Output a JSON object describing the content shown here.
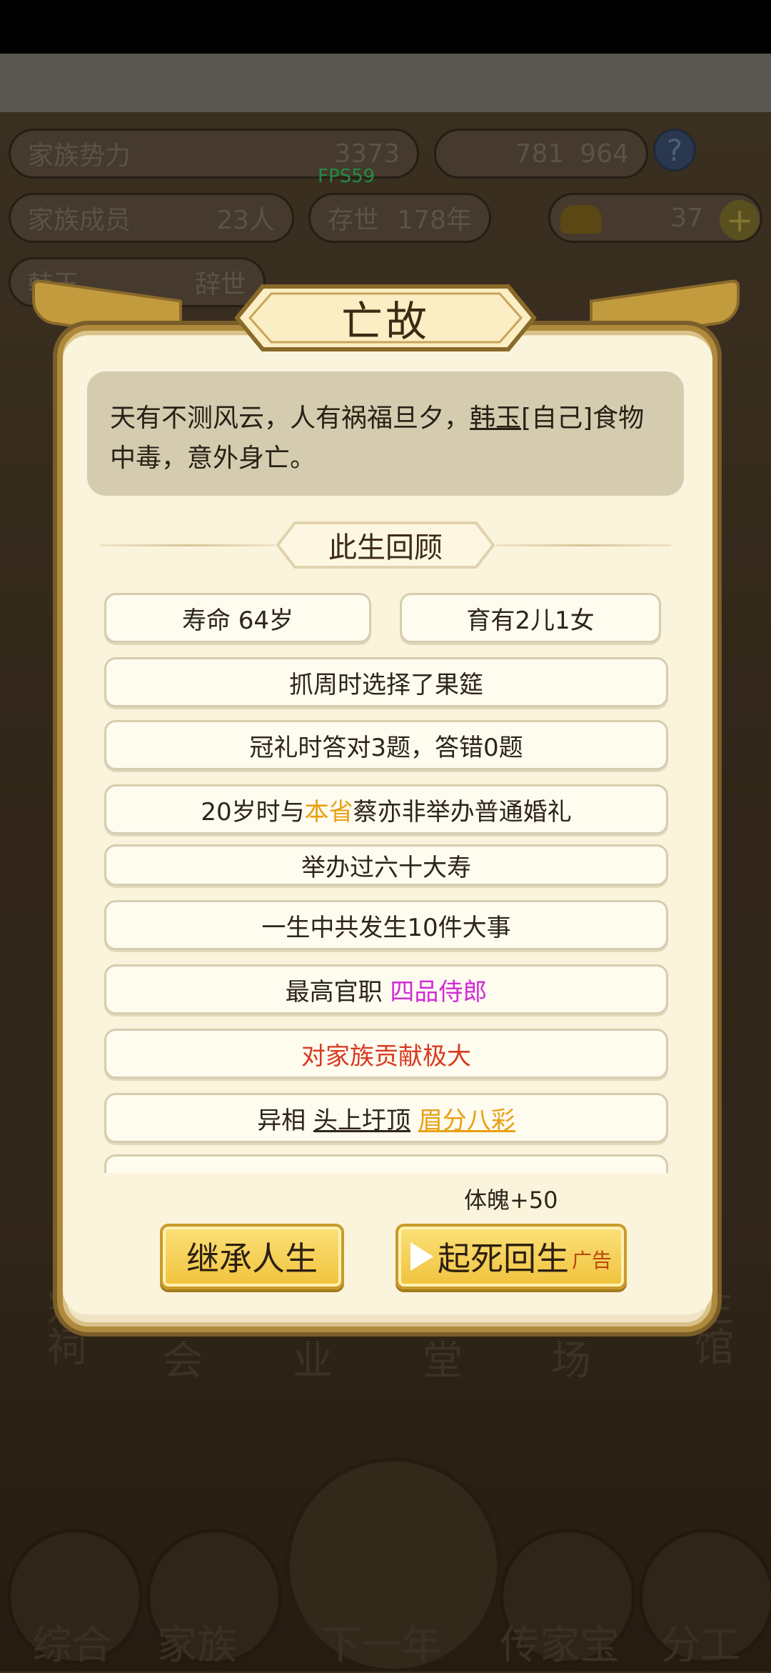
{
  "hud": {
    "clan_power_label": "家族势力",
    "clan_power_value": "3373",
    "fps": "FPS59",
    "currency_a": "781",
    "currency_b": "964",
    "hint_icon": "?",
    "members_label": "家族成员",
    "members_value": "23人",
    "existence_label": "存世",
    "existence_value": "178年",
    "gold_ingots": "37",
    "person_name": "韩玉",
    "person_status": "辞世"
  },
  "background": {
    "buildings": [
      "宗祠",
      "会",
      "业",
      "堂",
      "场",
      "生馆"
    ],
    "nav": [
      "综合",
      "家族",
      "下一年",
      "传家宝",
      "分工"
    ]
  },
  "modal": {
    "title": "亡故",
    "description": {
      "part1": "天有不测风云，人有祸福旦夕，",
      "name": "韩玉",
      "part2": "[自己]食物中毒，意外身亡。"
    },
    "review_title": "此生回顾",
    "items": {
      "lifespan": "寿命 64岁",
      "children": "育有2儿1女",
      "zhuazhou": "抓周时选择了果筵",
      "guanli": "冠礼时答对3题，答错0题",
      "marriage_pre": "20岁时与",
      "marriage_highlight": "本省",
      "marriage_post": "蔡亦非举办普通婚礼",
      "birthday": "举办过六十大寿",
      "events": "一生中共发生10件大事",
      "office_label": "最高官职",
      "office_value": "四品侍郎",
      "contribution": "对家族贡献极大",
      "features_label": "异相",
      "feature_1": "头上圩顶",
      "feature_2": "眉分八彩"
    },
    "bonus": "体魄+50",
    "btn_inherit": "继承人生",
    "btn_revive": "起死回生",
    "btn_revive_ad": "广告"
  },
  "colors": {
    "highlight_orange": "#e8a015",
    "office_magenta": "#d22ad8",
    "contribution_red": "#d83a22",
    "button_gold": "#f1c23c"
  }
}
